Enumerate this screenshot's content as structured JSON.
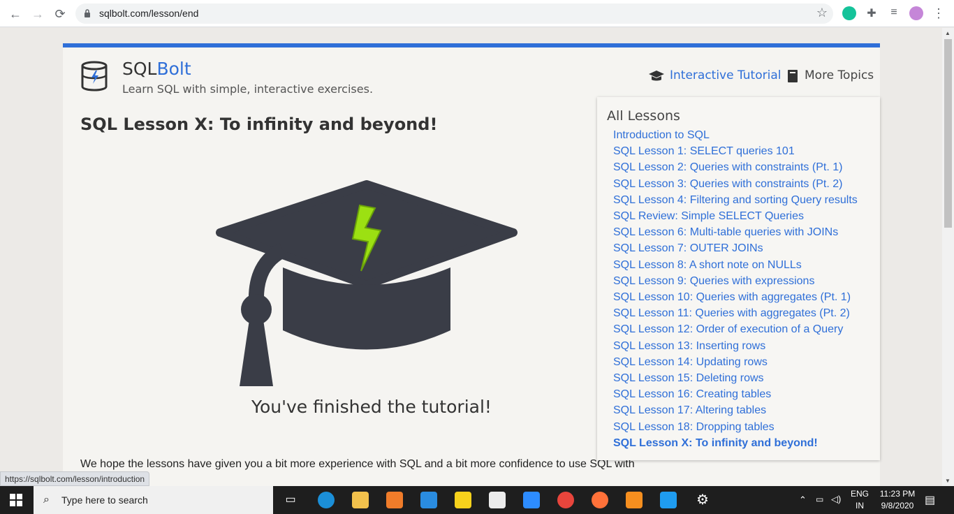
{
  "browser": {
    "url": "sqlbolt.com/lesson/end",
    "status_url": "https://sqlbolt.com/lesson/introduction"
  },
  "site": {
    "brand_prefix": "SQL",
    "brand_suffix": "Bolt",
    "tagline": "Learn SQL with simple, interactive exercises.",
    "nav": {
      "tutorial": "Interactive Tutorial",
      "more": "More Topics"
    },
    "accent": "#2f6fd8"
  },
  "main": {
    "title": "SQL Lesson X: To infinity and beyond!",
    "finished": "You've finished the tutorial!",
    "body_text": "We hope the lessons have given you a bit more experience with SQL and a bit more confidence to use SQL with"
  },
  "lessons": {
    "heading": "All Lessons",
    "items": [
      "Introduction to SQL",
      "SQL Lesson 1: SELECT queries 101",
      "SQL Lesson 2: Queries with constraints (Pt. 1)",
      "SQL Lesson 3: Queries with constraints (Pt. 2)",
      "SQL Lesson 4: Filtering and sorting Query results",
      "SQL Review: Simple SELECT Queries",
      "SQL Lesson 6: Multi-table queries with JOINs",
      "SQL Lesson 7: OUTER JOINs",
      "SQL Lesson 8: A short note on NULLs",
      "SQL Lesson 9: Queries with expressions",
      "SQL Lesson 10: Queries with aggregates (Pt. 1)",
      "SQL Lesson 11: Queries with aggregates (Pt. 2)",
      "SQL Lesson 12: Order of execution of a Query",
      "SQL Lesson 13: Inserting rows",
      "SQL Lesson 14: Updating rows",
      "SQL Lesson 15: Deleting rows",
      "SQL Lesson 16: Creating tables",
      "SQL Lesson 17: Altering tables",
      "SQL Lesson 18: Dropping tables",
      "SQL Lesson X: To infinity and beyond!"
    ]
  },
  "taskbar": {
    "search_placeholder": "Type here to search",
    "lang": "ENG",
    "region": "IN",
    "time": "11:23 PM",
    "date": "9/8/2020"
  }
}
